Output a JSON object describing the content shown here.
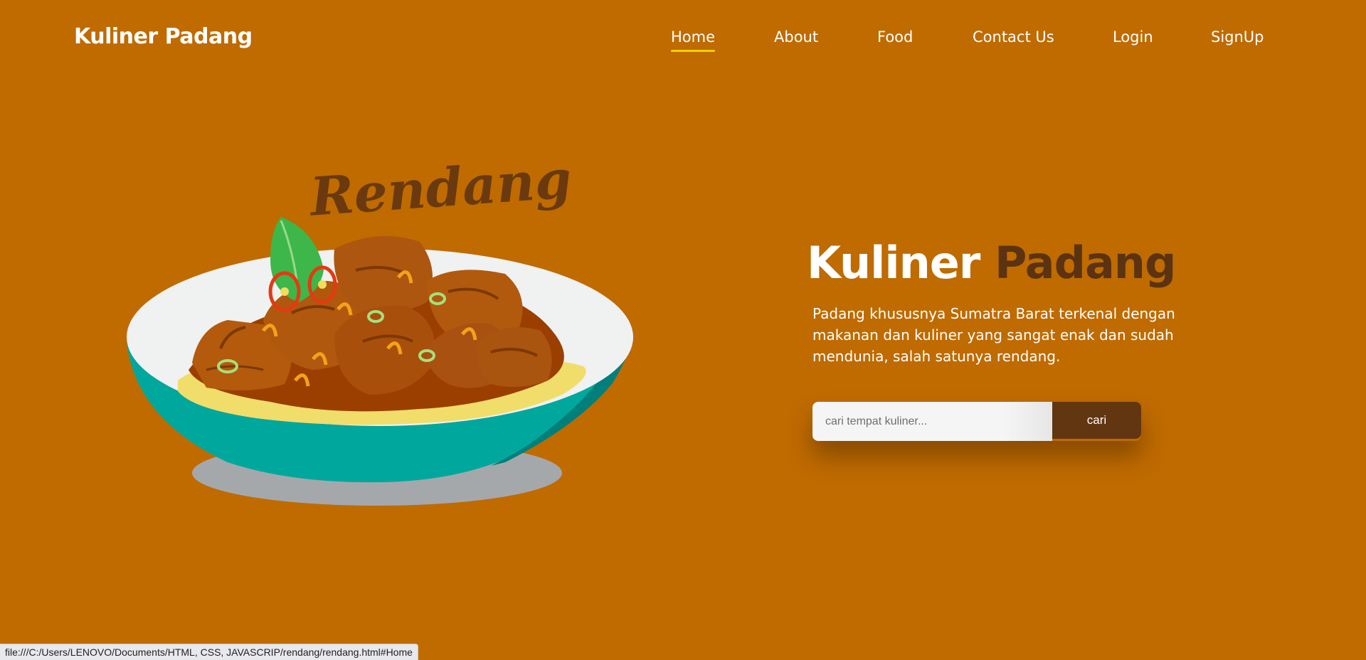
{
  "header": {
    "logo": "Kuliner Padang"
  },
  "nav": {
    "home": "Home",
    "about": "About",
    "food": "Food",
    "contact": "Contact Us",
    "login": "Login",
    "signup": "SignUp",
    "active": "Home"
  },
  "illustration": {
    "script_title": "Rendang",
    "subject": "rendang-dish-in-bowl"
  },
  "hero": {
    "title_white": "Kuliner",
    "title_brown": "Padang",
    "description": "Padang khususnya Sumatra Barat terkenal dengan makanan dan kuliner yang sangat enak dan sudah mendunia, salah satunya rendang."
  },
  "search": {
    "placeholder": "cari tempat kuliner...",
    "value": "",
    "button": "cari"
  },
  "status_bar": {
    "url": "file:///C:/Users/LENOVO/Documents/HTML, CSS, JAVASCRIP/rendang/rendang.html#Home"
  },
  "colors": {
    "background": "#bf6b00",
    "accent_dark": "#5c3310",
    "button": "#623610",
    "underline": "#f2d000",
    "bowl": "#00a79c"
  }
}
